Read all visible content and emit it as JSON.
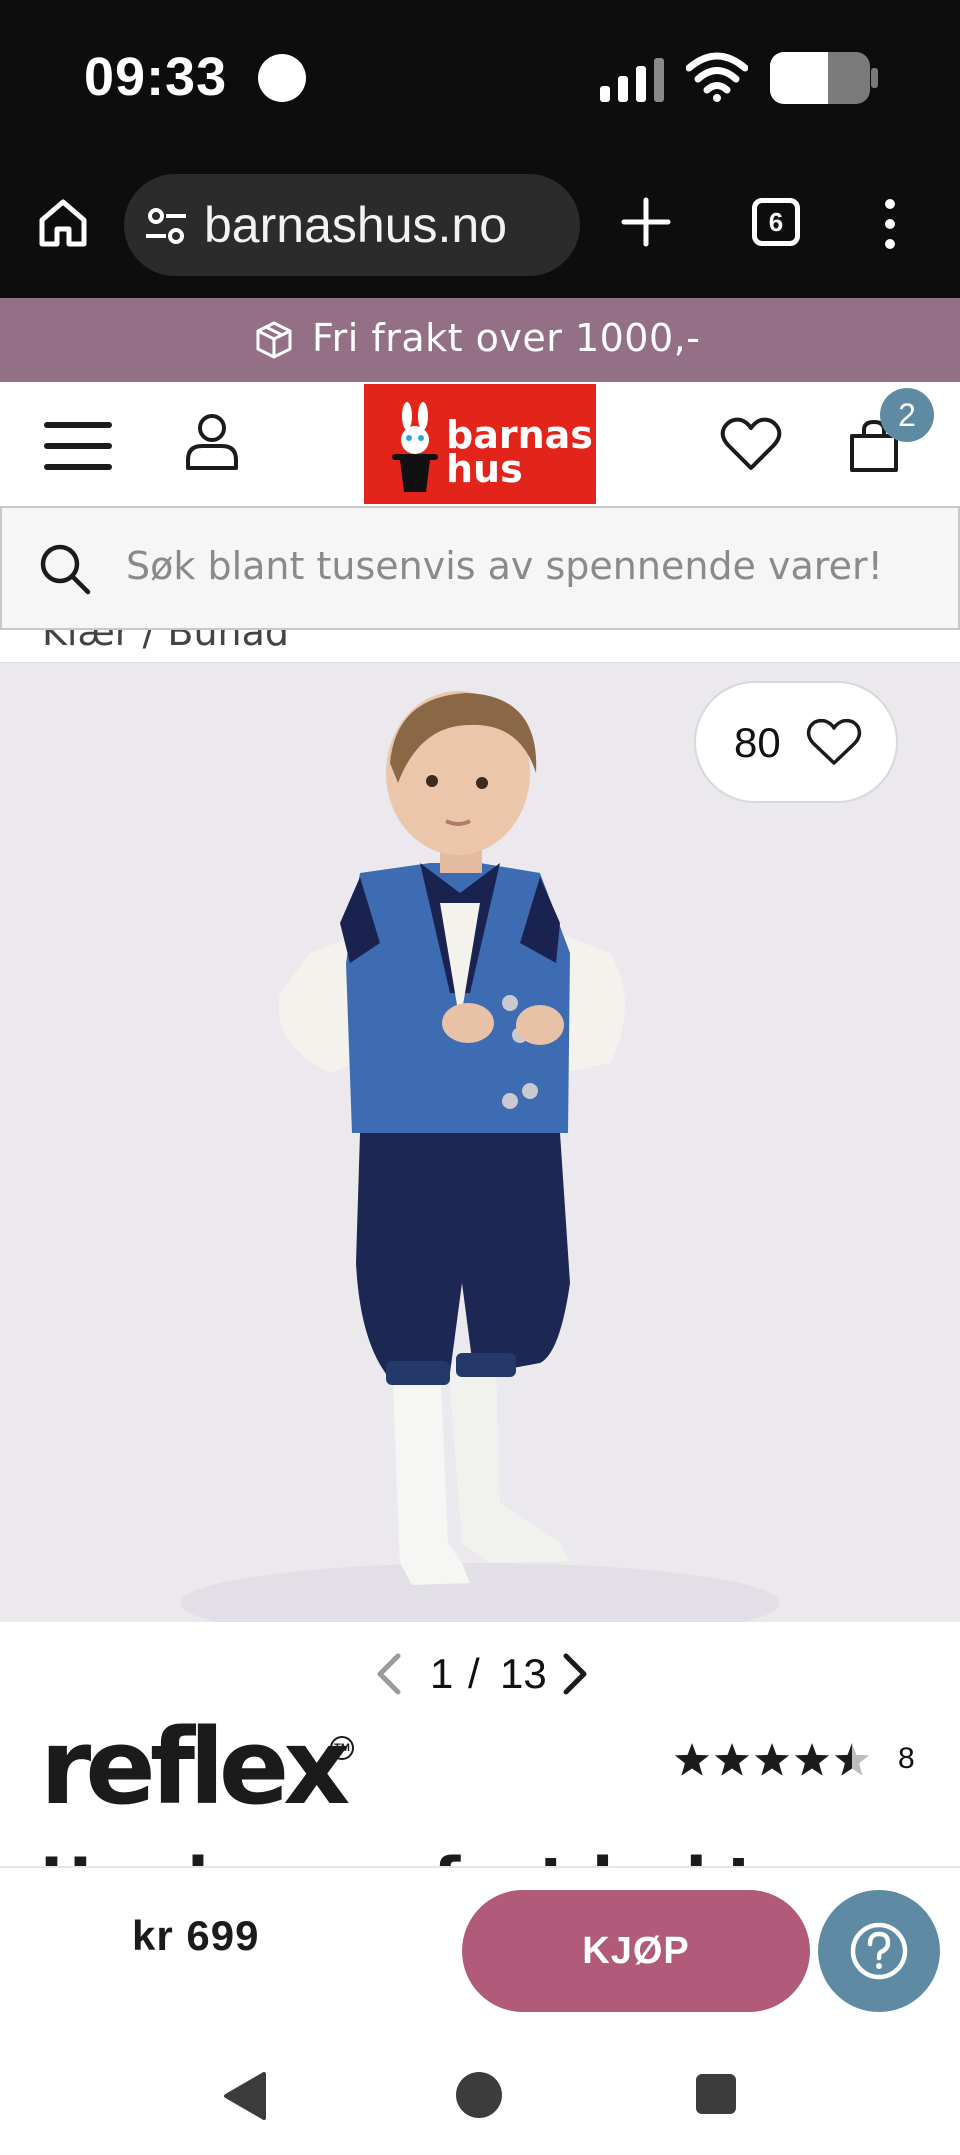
{
  "status_bar": {
    "time": "09:33"
  },
  "browser": {
    "url": "barnashus.no",
    "tab_count": "6"
  },
  "banner": {
    "text": "Fri frakt over 1000,-"
  },
  "header": {
    "logo_line1": "barnas",
    "logo_line2": "hus",
    "cart_count": "2"
  },
  "search": {
    "placeholder": "Søk blant tusenvis av spennende varer!"
  },
  "breadcrumb": {
    "text": "Klær  /  Bunad"
  },
  "gallery": {
    "favorites_count": "80",
    "current_image": "1",
    "separator": "/",
    "total_images": "13"
  },
  "product": {
    "brand": "reflex",
    "trademark": "TM",
    "rating_value": 4.5,
    "rating_count": "8",
    "title": "Hardanger festdrakt",
    "price": "kr 699",
    "buy_label": "KJØP"
  },
  "colors": {
    "banner": "#937085",
    "logo": "#e3241a",
    "accent_badge": "#5e8aa3",
    "buy_button": "#b15a79"
  }
}
